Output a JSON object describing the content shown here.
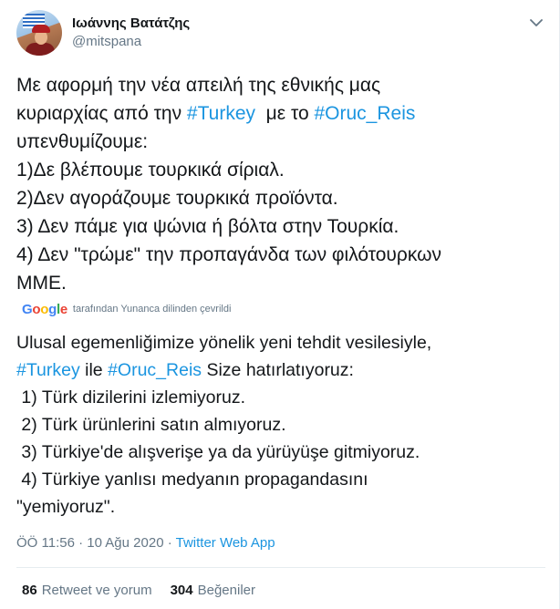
{
  "user": {
    "display_name": "Ιωάννης Βατάτζης",
    "handle": "@mitspana"
  },
  "tweet": {
    "lines": [
      [
        {
          "t": "Με αφορμή την νέα απειλή της εθνικής μας"
        }
      ],
      [
        {
          "t": "κυριαρχίας από την "
        },
        {
          "t": "#Turkey",
          "tag": true
        },
        {
          "t": "  με το "
        },
        {
          "t": "#Oruc_Reis",
          "tag": true
        }
      ],
      [
        {
          "t": "υπενθυμίζουμε:"
        }
      ],
      [
        {
          "t": "1)Δε βλέπουμε τουρκικά σίριαλ."
        }
      ],
      [
        {
          "t": "2)Δεν αγοράζουμε τουρκικά προϊόντα."
        }
      ],
      [
        {
          "t": "3) Δεν πάμε για ψώνια ή βόλτα στην Τουρκία."
        }
      ],
      [
        {
          "t": "4) Δεν \"τρώμε\" την προπαγάνδα των φιλότουρκων"
        }
      ],
      [
        {
          "t": "ΜΜΕ."
        }
      ]
    ]
  },
  "translation": {
    "logo": {
      "G": "G",
      "o1": "o",
      "o2": "o",
      "g": "g",
      "l": "l",
      "e": "e"
    },
    "label": "tarafından Yunanca dilinden çevrildi",
    "lines": [
      [
        {
          "t": "Ulusal egemenliğimize yönelik yeni tehdit vesilesiyle,"
        }
      ],
      [
        {
          "t": "#Turkey",
          "tag": true
        },
        {
          "t": " ile "
        },
        {
          "t": "#Oruc_Reis",
          "tag": true
        },
        {
          "t": " Size hatırlatıyoruz:"
        }
      ],
      [
        {
          "t": " 1) Türk dizilerini izlemiyoruz."
        }
      ],
      [
        {
          "t": " 2) Türk ürünlerini satın almıyoruz."
        }
      ],
      [
        {
          "t": " 3) Türkiye'de alışverişe ya da yürüyüşe gitmiyoruz."
        }
      ],
      [
        {
          "t": " 4) Türkiye yanlısı medyanın propagandasını"
        }
      ],
      [
        {
          "t": "\"yemiyoruz\"."
        }
      ]
    ]
  },
  "meta": {
    "time": "ÖÖ 11:56",
    "sep": " · ",
    "date": "10 Ağu 2020",
    "source": "Twitter Web App"
  },
  "stats": {
    "retweets": "86",
    "retweets_label": "Retweet ve yorum",
    "likes": "304",
    "likes_label": "Beğeniler"
  },
  "icons": {
    "more": "chevron-down-icon"
  },
  "colors": {
    "link": "#1b95e0",
    "secondary_text": "#657786",
    "divider": "#e6ecf0"
  }
}
